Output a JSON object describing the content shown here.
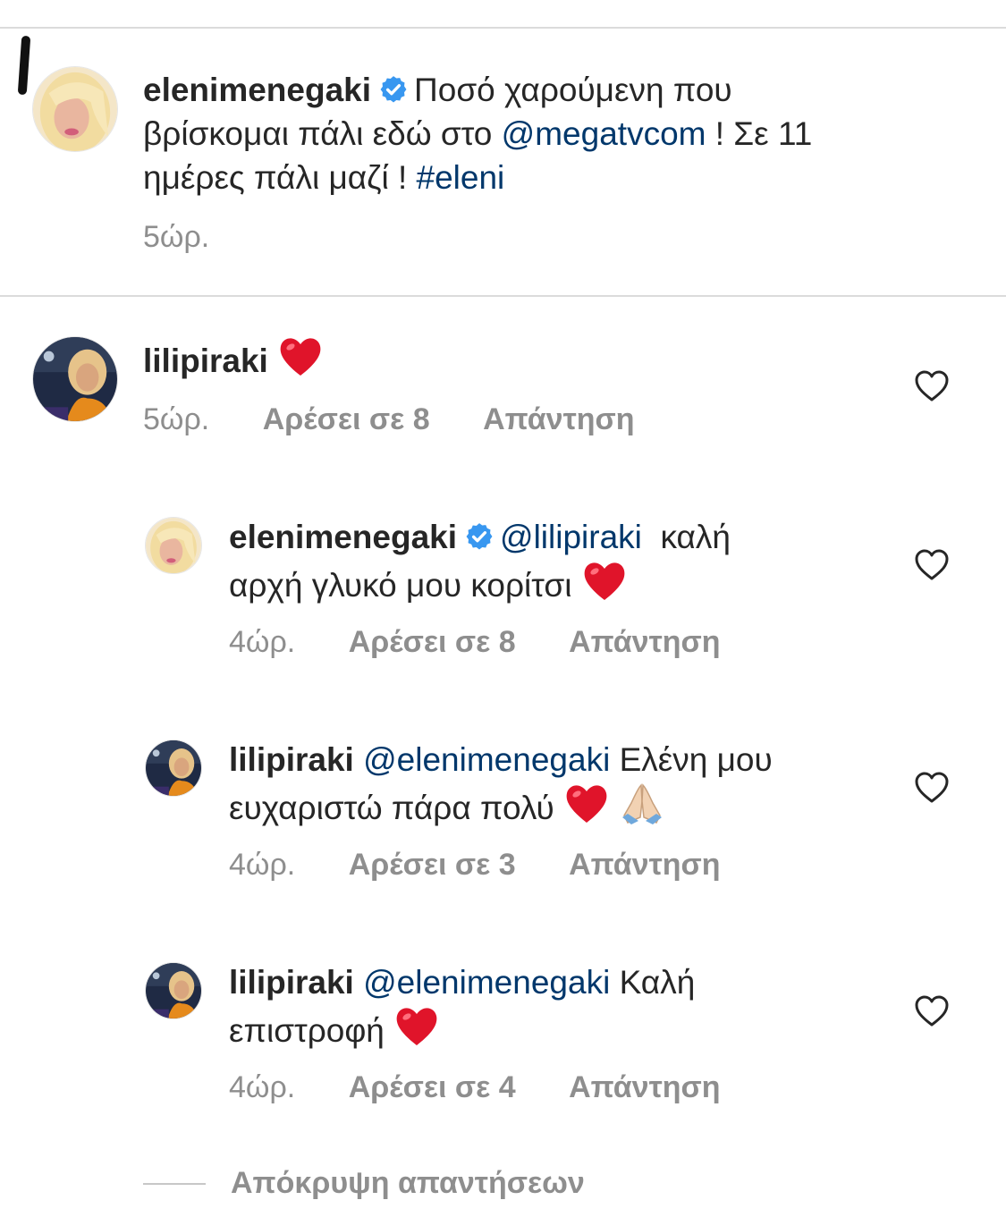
{
  "post": {
    "username": "elenimenegaki",
    "text_1": "Ποσό χαρούμενη που",
    "text_2": "βρίσκομαι πάλι εδώ στο",
    "mention": "@megatvcom",
    "text_3": "! Σε 11",
    "text_4": "ημέρες πάλι μαζί !",
    "hashtag": "#eleni",
    "time": "5ώρ."
  },
  "comment": {
    "username": "lilipiraki",
    "emoji": "heart-emoji",
    "time": "5ώρ.",
    "likes": "Αρέσει σε 8",
    "reply": "Απάντηση"
  },
  "replies": [
    {
      "username": "elenimenegaki",
      "verified": true,
      "mention": "@lilipiraki",
      "text_1": "καλή",
      "text_2": "αρχή γλυκό μου κορίτσι",
      "time": "4ώρ.",
      "likes": "Αρέσει σε 8",
      "reply": "Απάντηση"
    },
    {
      "username": "lilipiraki",
      "mention": "@elenimenegaki",
      "text_1": "Ελένη μου",
      "text_2": "ευχαριστώ πάρα πολύ",
      "time": "4ώρ.",
      "likes": "Αρέσει σε 3",
      "reply": "Απάντηση"
    },
    {
      "username": "lilipiraki",
      "mention": "@elenimenegaki",
      "text_1": "Καλή",
      "text_2": "επιστροφή",
      "time": "4ώρ.",
      "likes": "Αρέσει σε 4",
      "reply": "Απάντηση"
    }
  ],
  "hide_replies": "Απόκρυψη απαντήσεων",
  "colors": {
    "text": "#262626",
    "link": "#00376b",
    "meta": "#8e8e8e",
    "verified": "#3897f0",
    "heart": "#e0142a"
  },
  "icons": {
    "verified": "verified-badge-icon",
    "like": "heart-outline-icon",
    "heart": "red-heart-emoji",
    "pray": "folded-hands-emoji"
  }
}
